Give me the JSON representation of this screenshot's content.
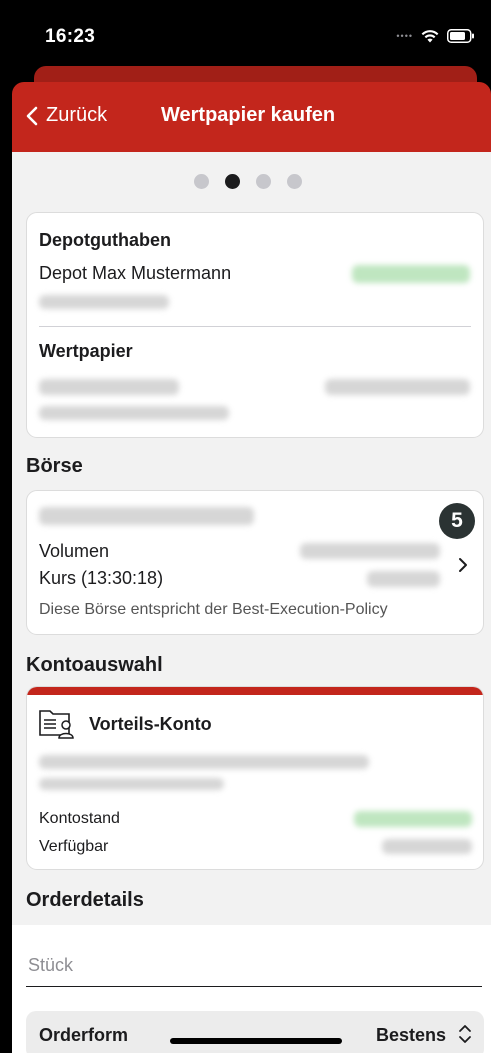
{
  "status_bar": {
    "time": "16:23"
  },
  "nav": {
    "back_label": "Zurück",
    "title": "Wertpapier kaufen"
  },
  "pager": {
    "total": 4,
    "active_index": 1
  },
  "depot_card": {
    "depot_label": "Depotguthaben",
    "depot_name": "Depot Max Mustermann",
    "security_label": "Wertpapier"
  },
  "boerse": {
    "section_title": "Börse",
    "step_badge": "5",
    "volume_label": "Volumen",
    "rate_label": "Kurs (13:30:18)",
    "policy_note": "Diese Börse entspricht der Best-Execution-Policy"
  },
  "kontoauswahl": {
    "section_title": "Kontoauswahl",
    "account_name": "Vorteils-Konto",
    "balance_label": "Kontostand",
    "available_label": "Verfügbar"
  },
  "orderdetails": {
    "section_title": "Orderdetails",
    "quantity_placeholder": "Stück",
    "orderform_label": "Orderform",
    "orderform_value": "Bestens"
  },
  "colors": {
    "brand_red": "#c3261c",
    "badge_dark": "#2b3333",
    "positive_green": "#bfe6c0"
  },
  "icons": [
    "wifi-icon",
    "battery-icon",
    "chevron-left-icon",
    "chevron-right-icon",
    "account-card-icon",
    "up-down-chevron-icon"
  ]
}
